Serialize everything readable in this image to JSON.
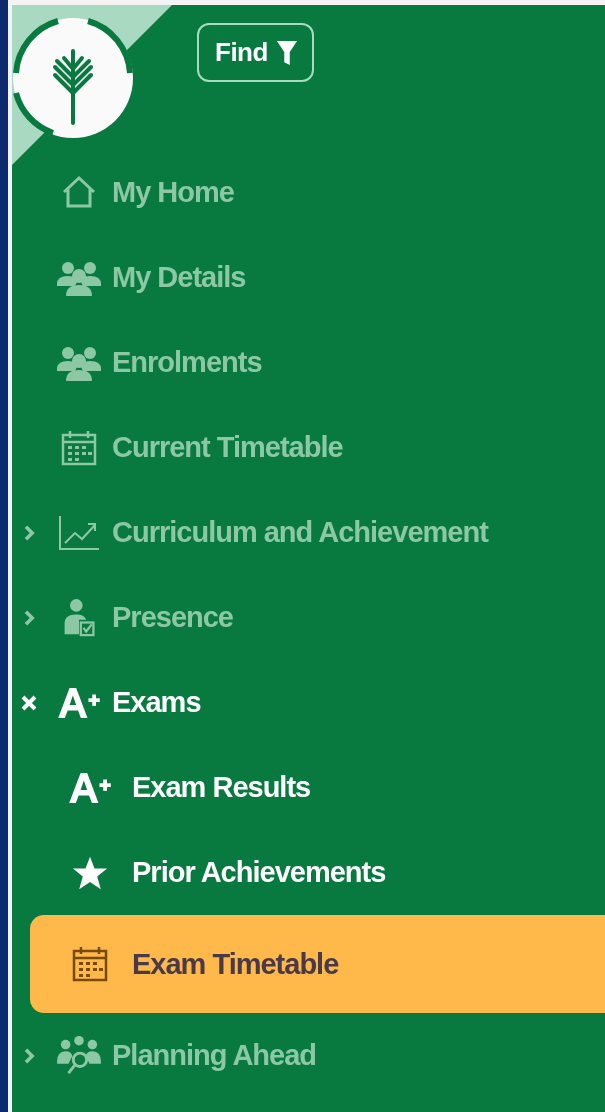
{
  "find_button": {
    "label": "Find"
  },
  "nav": [
    {
      "label": "My Home"
    },
    {
      "label": "My Details"
    },
    {
      "label": "Enrolments"
    },
    {
      "label": "Current Timetable"
    },
    {
      "label": "Curriculum and Achievement",
      "expanded": false
    },
    {
      "label": "Presence",
      "expanded": false
    },
    {
      "label": "Exams",
      "expanded": true,
      "children": [
        {
          "label": "Exam Results",
          "selected": false
        },
        {
          "label": "Prior Achievements",
          "selected": false
        },
        {
          "label": "Exam Timetable",
          "selected": true
        }
      ]
    },
    {
      "label": "Planning Ahead",
      "expanded": false
    }
  ]
}
